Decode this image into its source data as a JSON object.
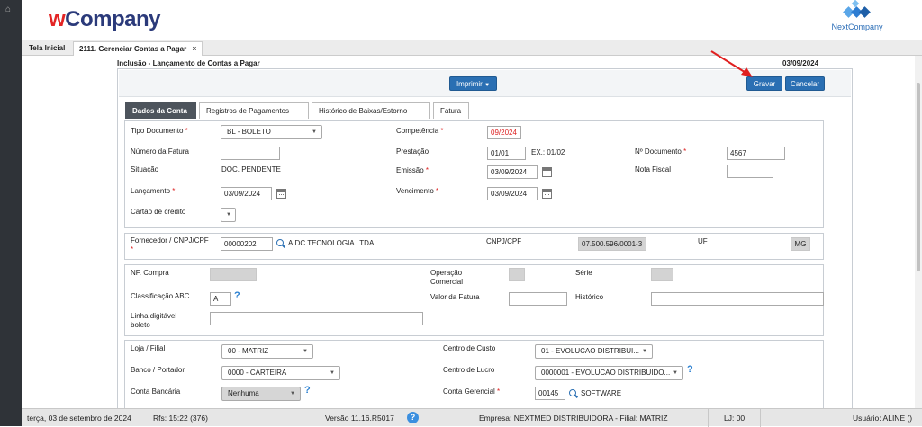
{
  "header": {
    "logo_w": "w",
    "logo_rest": "Company",
    "partner_logo": "NextCompany"
  },
  "tabs": [
    {
      "label": "Tela Inicial"
    },
    {
      "label": "2111. Gerenciar Contas a Pagar",
      "close": "×"
    }
  ],
  "page": {
    "title": "Inclusão - Lançamento de Contas a Pagar",
    "date": "03/09/2024"
  },
  "toolbar": {
    "print_label": "Imprimir",
    "save_label": "Gravar",
    "cancel_label": "Cancelar"
  },
  "subtabs": [
    {
      "label": "Dados da Conta"
    },
    {
      "label": "Registros de Pagamentos"
    },
    {
      "label": "Histórico de Baixas/Estorno"
    },
    {
      "label": "Fatura"
    }
  ],
  "account": {
    "tipo_documento_label": "Tipo Documento",
    "tipo_documento": "BL - BOLETO",
    "competencia_label": "Competência",
    "competencia": "09/2024",
    "numero_fatura_label": "Número da Fatura",
    "numero_fatura": "",
    "prestacao_label": "Prestação",
    "prestacao": "01/01",
    "prestacao_hint": "EX.: 01/02",
    "n_documento_label": "Nº Documento",
    "n_documento": "4567",
    "situacao_label": "Situação",
    "situacao": "DOC. PENDENTE",
    "emissao_label": "Emissão",
    "emissao": "03/09/2024",
    "nota_fiscal_label": "Nota Fiscal",
    "nota_fiscal": "",
    "lancamento_label": "Lançamento",
    "lancamento": "03/09/2024",
    "vencimento_label": "Vencimento",
    "vencimento": "03/09/2024",
    "cartao_label": "Cartão de crédito",
    "required_mark": "*"
  },
  "supplier": {
    "label": "Fornecedor / CNPJ/CPF",
    "code": "00000202",
    "name": "AIDC TECNOLOGIA LTDA",
    "cnpj_label": "CNPJ/CPF",
    "cnpj": "07.500.596/0001-3",
    "uf_label": "UF",
    "uf": "MG"
  },
  "purchase": {
    "nf_compra_label": "NF. Compra",
    "operacao_label_1": "Operação",
    "operacao_label_2": "Comercial",
    "serie_label": "Série",
    "classificacao_label": "Classificação ABC",
    "classificacao": "A",
    "valor_fatura_label": "Valor da Fatura",
    "historico_label": "Histórico",
    "linha_label_1": "Linha digitável",
    "linha_label_2": "boleto",
    "help": "?"
  },
  "finance": {
    "loja_label": "Loja / Filial",
    "loja": "00 - MATRIZ",
    "centro_custo_label": "Centro de Custo",
    "centro_custo": "01 - EVOLUCAO DISTRIBUI...",
    "banco_label": "Banco / Portador",
    "banco": "0000 - CARTEIRA",
    "centro_lucro_label": "Centro de Lucro",
    "centro_lucro": "0000001 - EVOLUCAO DISTRIBUIDO...",
    "conta_bancaria_label": "Conta Bancária",
    "conta_bancaria": "Nenhuma",
    "conta_gerencial_label": "Conta Gerencial",
    "conta_gerencial_code": "00145",
    "conta_gerencial_name": "SOFTWARE"
  },
  "status": {
    "datetime": "terça, 03 de setembro de 2024",
    "rfs": "Rfs: 15:22 (376)",
    "version": "Versão 11.16.R5017",
    "help": "?",
    "empresa": "Empresa: NEXTMED DISTRIBUIDORA - Filial: MATRIZ",
    "lj": "LJ: 00",
    "usuario": "Usuário: ALINE ()"
  },
  "colors": {
    "primary_button": "#2a6fb3",
    "active_tab": "#4d545c",
    "required": "#dd2222",
    "annotation_arrow": "#e02020"
  },
  "icons": [
    "home-icon",
    "close-icon",
    "chevron-down-icon",
    "calendar-icon",
    "search-icon",
    "help-icon",
    "annotation-arrow"
  ]
}
